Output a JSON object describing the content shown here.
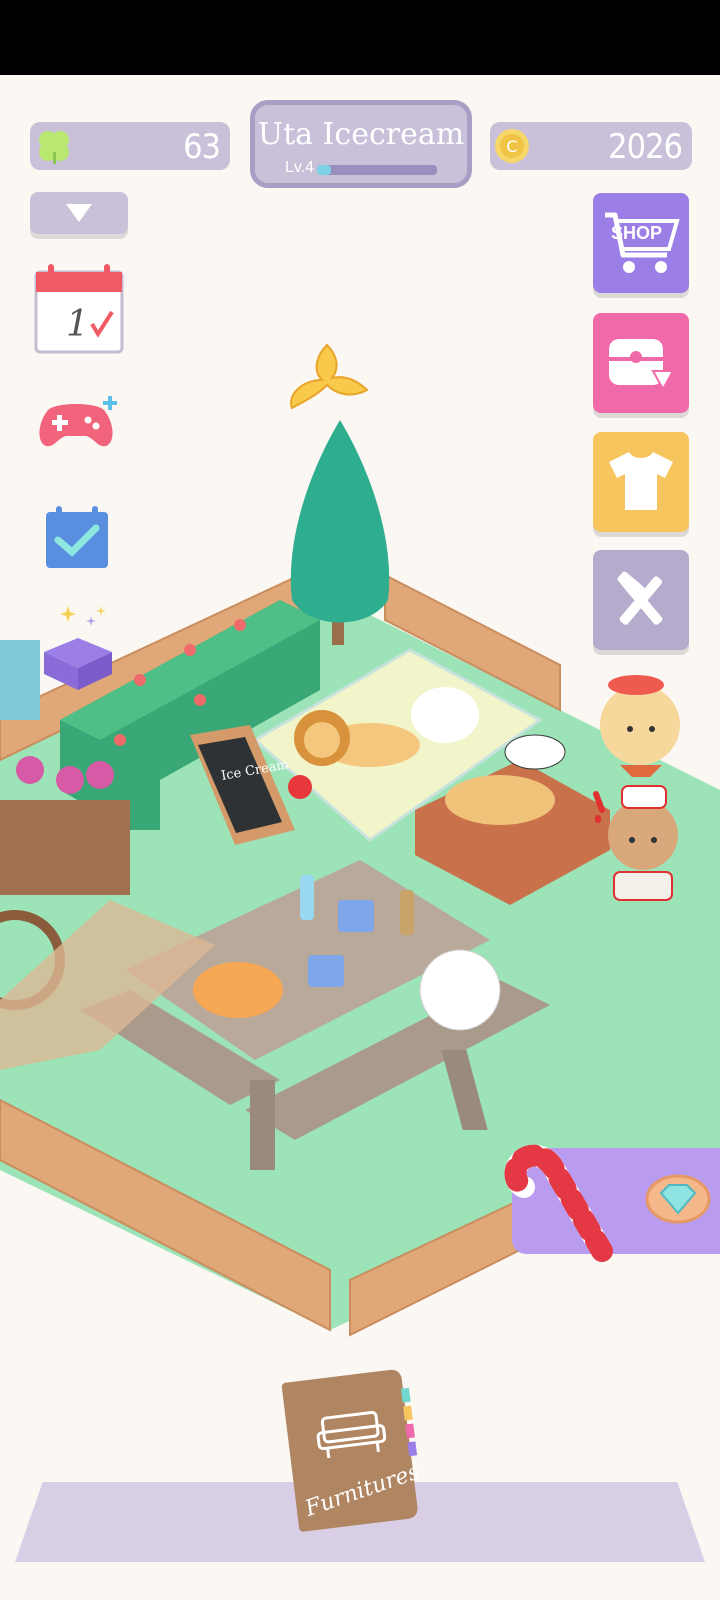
{
  "hud": {
    "clover_count": "63",
    "coin_count": "2026",
    "shop_name": "Uta Icecream",
    "level_label": "Lv.4",
    "level_progress": 0.12,
    "coin_symbol": "C"
  },
  "right_menu": {
    "shop_label": "SHOP"
  },
  "scene": {
    "chalkboard_text": "Ice Cream",
    "furniture_book_label": "Furnitures"
  },
  "colors": {
    "hud_pill": "#c9c1d9",
    "shop_button": "#9b7ee6",
    "chest_button": "#f06aa9",
    "clothes_button": "#f7c55e",
    "tools_button": "#b6aacd",
    "lawn": "#9ce3b8",
    "fence": "#e0a778",
    "bottom_bar": "#d8cfe6"
  },
  "icons": [
    "clover-icon",
    "coin-icon",
    "dropdown-arrow-icon",
    "calendar-icon",
    "gamepad-icon",
    "checklist-icon",
    "gift-box-icon",
    "cart-icon",
    "chest-icon",
    "tshirt-icon",
    "tools-icon",
    "gem-icon",
    "banana-peel-icon",
    "candy-cane-icon"
  ]
}
